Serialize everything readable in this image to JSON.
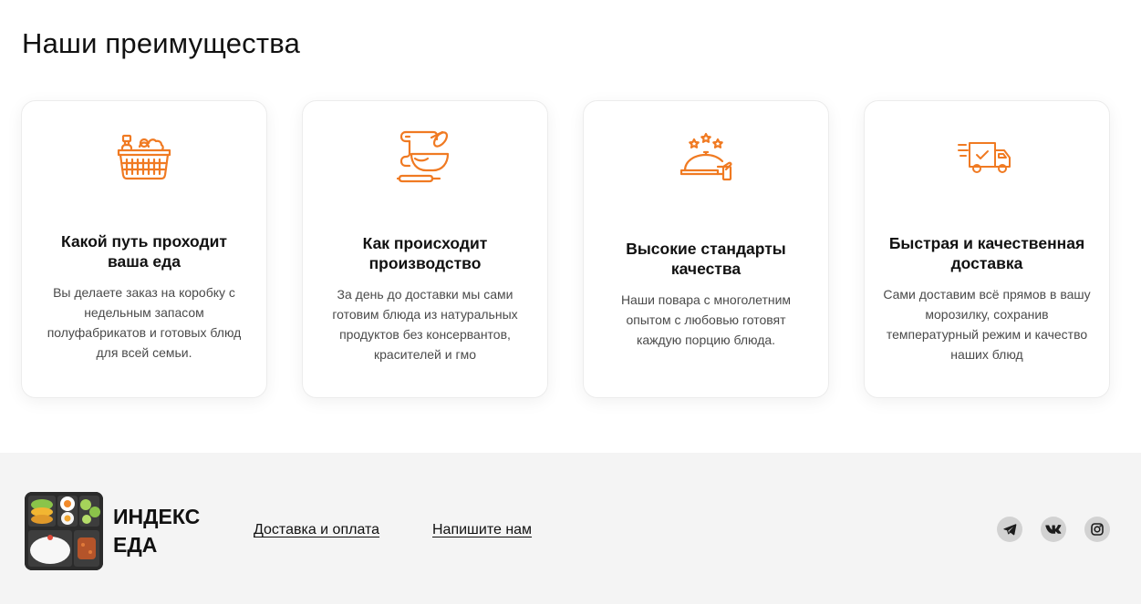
{
  "section": {
    "title": "Наши преимущества"
  },
  "colors": {
    "accent": "#f07a22",
    "footer_bg": "#f4f4f4",
    "social_bg": "#d2d2d2"
  },
  "cards": [
    {
      "icon": "food-basket-icon",
      "title": "Какой путь проходит ваша еда",
      "text": "Вы делаете заказ на коробку с недельным запасом полуфабрикатов и готовых блюд для всей семьи."
    },
    {
      "icon": "baking-whisk-icon",
      "title": "Как происходит производство",
      "text": "За день до доставки мы сами готовим блюда из натуральных продуктов без консервантов, красителей и гмо"
    },
    {
      "icon": "serving-cloche-stars-icon",
      "title": "Высокие стандарты качества",
      "text": "Наши повара с многолетним опытом с любовью готовят каждую порцию блюда."
    },
    {
      "icon": "delivery-truck-icon",
      "title": "Быстрая и качественная доставка",
      "text": "Сами доставим всё прямов в вашу морозилку, сохранив температурный режим и качество наших блюд"
    }
  ],
  "footer": {
    "logo_icon": "bento-box-logo",
    "brand_line1": "ИНДЕКС",
    "brand_line2": "ЕДА",
    "links": [
      "Доставка и оплата",
      "Напишите нам"
    ],
    "socials": [
      "telegram-icon",
      "vk-icon",
      "instagram-icon"
    ]
  }
}
